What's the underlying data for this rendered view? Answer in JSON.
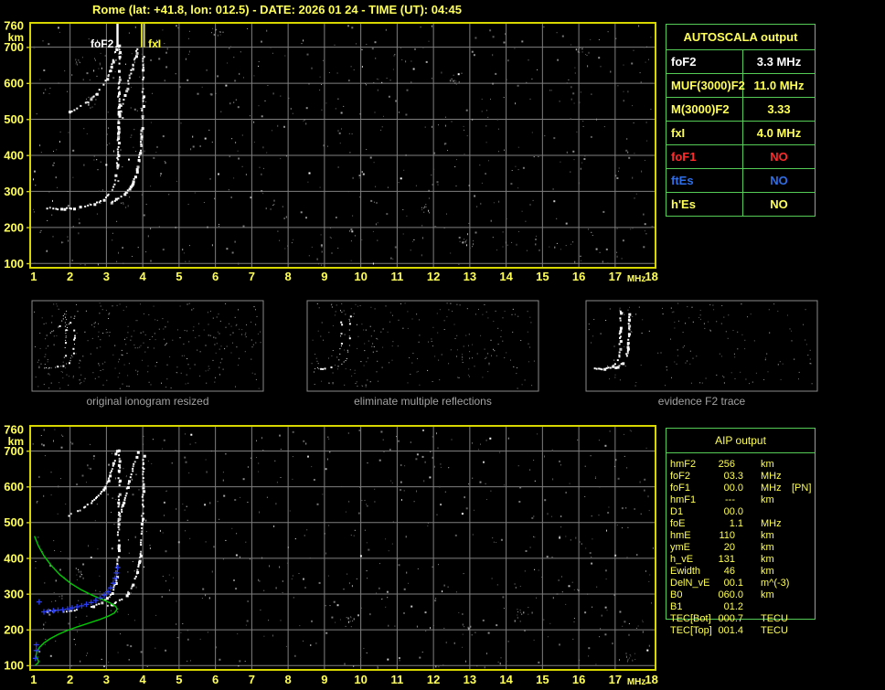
{
  "window_title": "Rome (lat: +41.8, lon: 012.5) - DATE: 2026 01 24 - TIME (UT): 04:45",
  "autoscala": {
    "title": "AUTOSCALA output",
    "rows": [
      {
        "label": "foF2",
        "value": "3.3 MHz",
        "color": "#ffffff"
      },
      {
        "label": "MUF(3000)F2",
        "value": "11.0 MHz",
        "color": "#ffff55"
      },
      {
        "label": "M(3000)F2",
        "value": "3.33",
        "color": "#ffff55"
      },
      {
        "label": "fxI",
        "value": "4.0 MHz",
        "color": "#ffff55"
      },
      {
        "label": "foF1",
        "value": "NO",
        "color": "#ff2a2a"
      },
      {
        "label": "ftEs",
        "value": "NO",
        "color": "#2e6fe8"
      },
      {
        "label": "h'Es",
        "value": "NO",
        "color": "#ffff55"
      }
    ]
  },
  "aip": {
    "title": "AIP output",
    "rows": [
      {
        "label": "hmF2",
        "value": "256",
        "unit": "km",
        "note": ""
      },
      {
        "label": "foF2",
        "value": "03.3",
        "unit": "MHz",
        "note": ""
      },
      {
        "label": "foF1",
        "value": "00.0",
        "unit": "MHz",
        "note": "[PN]"
      },
      {
        "label": "hmF1",
        "value": "---",
        "unit": "km",
        "note": ""
      },
      {
        "label": "D1",
        "value": "00.0",
        "unit": "",
        "note": ""
      },
      {
        "label": "foE",
        "value": "1.1",
        "unit": "MHz",
        "note": ""
      },
      {
        "label": "hmE",
        "value": "110",
        "unit": "km",
        "note": ""
      },
      {
        "label": "ymE",
        "value": "20",
        "unit": "km",
        "note": ""
      },
      {
        "label": "h_vE",
        "value": "131",
        "unit": "km",
        "note": ""
      },
      {
        "label": "Ewidth",
        "value": "46",
        "unit": "km",
        "note": ""
      },
      {
        "label": "DelN_vE",
        "value": "00.1",
        "unit": "m^(-3)",
        "note": ""
      },
      {
        "label": "B0",
        "value": "060.0",
        "unit": "km",
        "note": ""
      },
      {
        "label": "B1",
        "value": "01.2",
        "unit": "",
        "note": ""
      },
      {
        "label": "TEC[Bot]",
        "value": "000.7",
        "unit": "TECU",
        "note": ""
      },
      {
        "label": "TEC[Top]",
        "value": "001.4",
        "unit": "TECU",
        "note": ""
      }
    ]
  },
  "thumbnails": [
    {
      "caption": "original ionogram resized"
    },
    {
      "caption": "eliminate multiple reflections"
    },
    {
      "caption": "evidence F2 trace"
    }
  ],
  "chart_data": {
    "type": "scatter",
    "x_unit": "MHz",
    "y_unit": "km",
    "xlim": [
      1,
      18
    ],
    "ylim": [
      100,
      760
    ],
    "xticks": [
      1,
      2,
      3,
      4,
      5,
      6,
      7,
      8,
      9,
      10,
      11,
      12,
      13,
      14,
      15,
      16,
      17,
      18
    ],
    "yticks": [
      100,
      200,
      300,
      400,
      500,
      600,
      700,
      760
    ],
    "grid": true,
    "series": {
      "f2_o_trace": {
        "style": "dots",
        "color": "#ffffff",
        "points": [
          [
            1.35,
            256
          ],
          [
            1.5,
            255
          ],
          [
            1.65,
            254
          ],
          [
            1.8,
            254
          ],
          [
            1.95,
            255
          ],
          [
            2.1,
            257
          ],
          [
            2.25,
            259
          ],
          [
            2.4,
            262
          ],
          [
            2.55,
            266
          ],
          [
            2.7,
            271
          ],
          [
            2.83,
            277
          ],
          [
            2.95,
            285
          ],
          [
            3.05,
            295
          ],
          [
            3.13,
            307
          ],
          [
            3.19,
            322
          ],
          [
            3.24,
            341
          ],
          [
            3.27,
            365
          ],
          [
            3.29,
            395
          ],
          [
            3.3,
            432
          ],
          [
            3.31,
            475
          ],
          [
            3.315,
            525
          ],
          [
            3.32,
            580
          ],
          [
            3.325,
            635
          ],
          [
            3.33,
            690
          ],
          [
            3.33,
            715
          ]
        ]
      },
      "f2_x_trace": {
        "style": "dots",
        "color": "#ffffff",
        "points": [
          [
            2.95,
            266
          ],
          [
            3.1,
            272
          ],
          [
            3.25,
            280
          ],
          [
            3.4,
            289
          ],
          [
            3.52,
            300
          ],
          [
            3.63,
            314
          ],
          [
            3.72,
            331
          ],
          [
            3.8,
            352
          ],
          [
            3.86,
            378
          ],
          [
            3.91,
            410
          ],
          [
            3.94,
            448
          ],
          [
            3.96,
            492
          ],
          [
            3.975,
            540
          ],
          [
            3.985,
            592
          ],
          [
            3.99,
            645
          ],
          [
            4.0,
            695
          ]
        ]
      },
      "o_second_reflection": {
        "style": "dots",
        "color": "#ffffff",
        "points": [
          [
            1.95,
            522
          ],
          [
            2.15,
            532
          ],
          [
            2.35,
            544
          ],
          [
            2.55,
            558
          ],
          [
            2.72,
            574
          ],
          [
            2.88,
            593
          ],
          [
            3.0,
            615
          ],
          [
            3.1,
            640
          ],
          [
            3.18,
            668
          ],
          [
            3.24,
            697
          ],
          [
            3.28,
            715
          ]
        ]
      },
      "x_second_reflection": {
        "style": "dots",
        "color": "#ffffff",
        "points": [
          [
            3.32,
            512
          ],
          [
            3.4,
            540
          ],
          [
            3.48,
            570
          ],
          [
            3.57,
            603
          ],
          [
            3.66,
            638
          ],
          [
            3.76,
            673
          ],
          [
            3.85,
            705
          ]
        ]
      },
      "electron_density_profile": {
        "style": "line",
        "color": "#00cc00",
        "points": [
          [
            1.02,
            462
          ],
          [
            1.13,
            434
          ],
          [
            1.28,
            407
          ],
          [
            1.48,
            380
          ],
          [
            1.72,
            354
          ],
          [
            2.0,
            331
          ],
          [
            2.3,
            312
          ],
          [
            2.6,
            297
          ],
          [
            2.88,
            285
          ],
          [
            3.1,
            275
          ],
          [
            3.25,
            266
          ],
          [
            3.3,
            258
          ],
          [
            3.22,
            247
          ],
          [
            3.05,
            238
          ],
          [
            2.8,
            228
          ],
          [
            2.5,
            218
          ],
          [
            2.2,
            208
          ],
          [
            1.92,
            198
          ],
          [
            1.67,
            187
          ],
          [
            1.45,
            175
          ],
          [
            1.28,
            163
          ],
          [
            1.16,
            151
          ],
          [
            1.09,
            139
          ],
          [
            1.06,
            128
          ],
          [
            1.1,
            118
          ],
          [
            1.14,
            111
          ],
          [
            1.1,
            105
          ],
          [
            1.04,
            101
          ]
        ]
      },
      "restored_virtual_heights": {
        "style": "plus",
        "color": "#2a3cf0",
        "points": [
          [
            1.28,
            250
          ],
          [
            1.41,
            252
          ],
          [
            1.54,
            253
          ],
          [
            1.67,
            255
          ],
          [
            1.8,
            256
          ],
          [
            1.93,
            258
          ],
          [
            2.06,
            261
          ],
          [
            2.19,
            264
          ],
          [
            2.32,
            267
          ],
          [
            2.45,
            271
          ],
          [
            2.58,
            276
          ],
          [
            2.71,
            282
          ],
          [
            2.83,
            289
          ],
          [
            2.94,
            297
          ],
          [
            3.04,
            306
          ],
          [
            3.12,
            317
          ],
          [
            3.19,
            330
          ],
          [
            3.24,
            344
          ],
          [
            3.28,
            359
          ],
          [
            3.31,
            374
          ],
          [
            1.15,
            278
          ],
          [
            1.07,
            158
          ],
          [
            1.07,
            142
          ],
          [
            1.05,
            120
          ]
        ]
      }
    },
    "plots": [
      {
        "name": "scaled-ionogram",
        "series": [
          "f2_o_trace",
          "f2_x_trace",
          "o_second_reflection",
          "x_second_reflection"
        ],
        "markers": [
          {
            "label": "foF2",
            "x": 3.3,
            "color": "#ffffff",
            "side": "left",
            "double": false
          },
          {
            "label": "fxI",
            "x": 4.0,
            "color": "#ffff33",
            "side": "right",
            "double": true
          }
        ],
        "noise_count": 680,
        "noise_seed": 11
      },
      {
        "name": "ionogram-with-profile",
        "series": [
          "f2_o_trace",
          "f2_x_trace",
          "o_second_reflection",
          "x_second_reflection",
          "electron_density_profile",
          "restored_virtual_heights"
        ],
        "markers": [],
        "noise_count": 620,
        "noise_seed": 23
      }
    ],
    "thumb_plots": [
      {
        "series": [
          "f2_o_trace",
          "f2_x_trace",
          "o_second_reflection",
          "x_second_reflection"
        ],
        "noise_count": 300,
        "noise_seed": 31,
        "bold": false
      },
      {
        "series": [
          "f2_o_trace",
          "f2_x_trace"
        ],
        "noise_count": 230,
        "noise_seed": 47,
        "bold": false
      },
      {
        "series": [
          "f2_o_trace",
          "f2_x_trace"
        ],
        "noise_count": 150,
        "noise_seed": 59,
        "bold": true
      }
    ]
  },
  "colors": {
    "text_yellow": "#ffff55",
    "frame_yellow": "#d8d800",
    "grid_gray": "#7f7f7f",
    "table_green": "#55cc55",
    "caption_gray": "#a2a2a2",
    "status_red": "#ff2a2a",
    "status_blue": "#2e6fe8",
    "profile_green": "#00cc00",
    "restored_blue": "#2a3cf0"
  }
}
